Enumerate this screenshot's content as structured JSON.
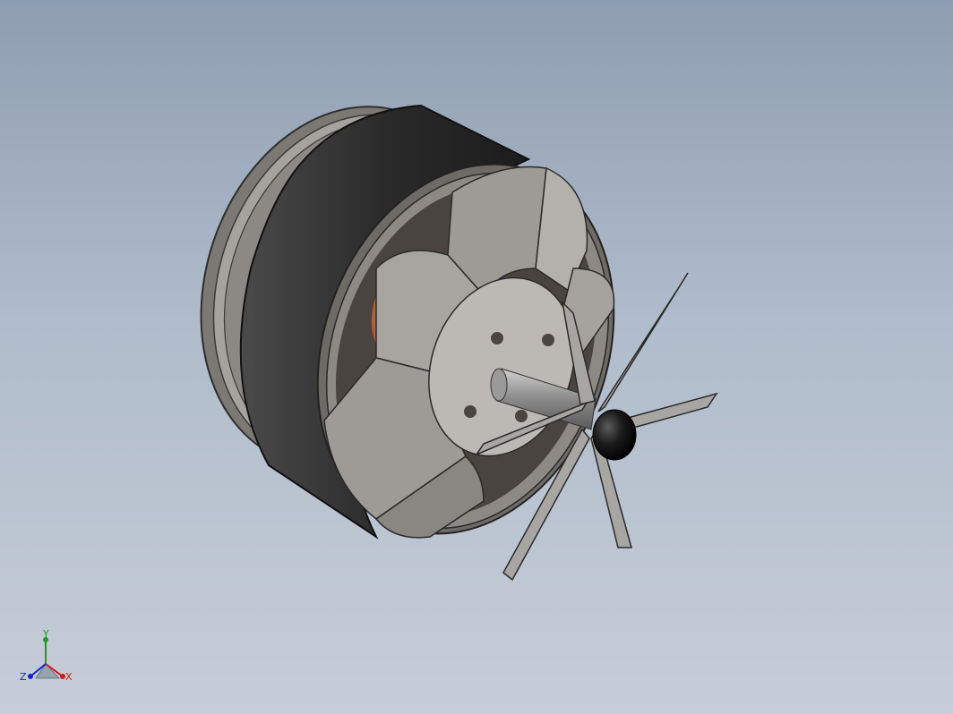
{
  "viewport": {
    "background_top": "#8e9db1",
    "background_bottom": "#c6cdd8"
  },
  "model": {
    "parts": [
      "motor-can",
      "stator-windings",
      "motor-mount",
      "shaft",
      "propeller",
      "spinner"
    ],
    "colors": {
      "can": "#2a2a2a",
      "mount": "#9a9692",
      "coil": "#b8704c",
      "insulator": "#1f2fa8",
      "blade": "#a8a6a2",
      "spinner": "#111111"
    }
  },
  "triad": {
    "x_label": "X",
    "y_label": "Y",
    "z_label": "Z",
    "x_color": "#d01818",
    "y_color": "#18a018",
    "z_color": "#1828c8"
  }
}
